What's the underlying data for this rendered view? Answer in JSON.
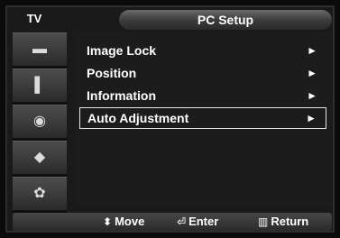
{
  "header": {
    "source_label": "TV",
    "title": "PC Setup"
  },
  "sidebar": {
    "items": [
      {
        "icon": "input-icon",
        "glyph": "▬"
      },
      {
        "icon": "picture-icon",
        "glyph": "▌"
      },
      {
        "icon": "sound-icon",
        "glyph": "◉"
      },
      {
        "icon": "channel-icon",
        "glyph": "◆"
      },
      {
        "icon": "setup-icon",
        "glyph": "✿"
      }
    ]
  },
  "menu": {
    "items": [
      {
        "label": "Image Lock",
        "arrow": "►",
        "selected": false
      },
      {
        "label": "Position",
        "arrow": "►",
        "selected": false
      },
      {
        "label": "Information",
        "arrow": "►",
        "selected": false
      },
      {
        "label": "Auto Adjustment",
        "arrow": "►",
        "selected": true
      }
    ]
  },
  "footer": {
    "move": {
      "icon": "updown-arrows-icon",
      "glyph": "⬍",
      "label": "Move"
    },
    "enter": {
      "icon": "enter-icon",
      "glyph": "⏎",
      "label": "Enter"
    },
    "return": {
      "icon": "return-icon",
      "glyph": "▥",
      "label": "Return"
    }
  }
}
